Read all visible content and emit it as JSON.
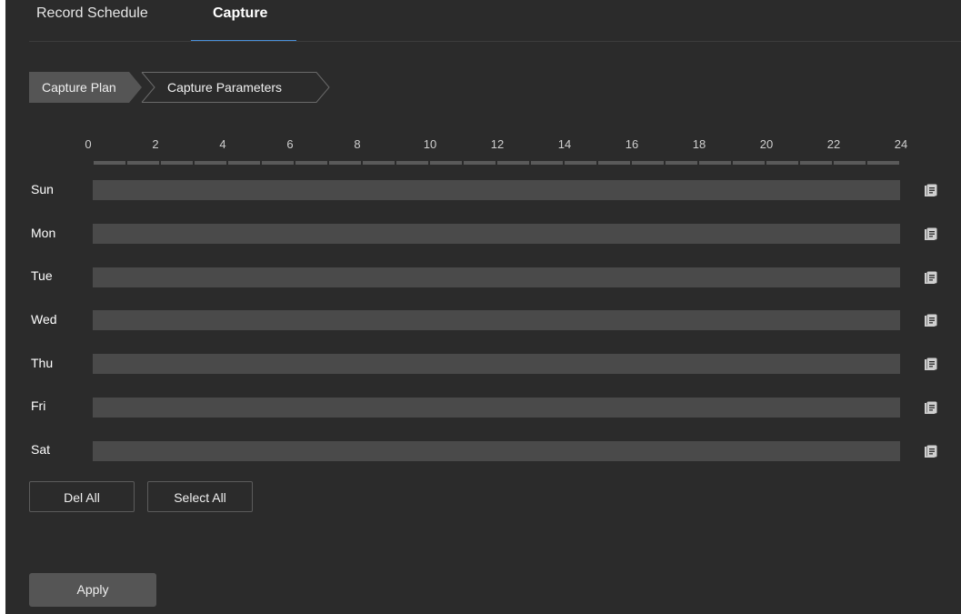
{
  "tabs": [
    {
      "label": "Record Schedule",
      "active": false
    },
    {
      "label": "Capture",
      "active": true
    }
  ],
  "steps": [
    {
      "label": "Capture Plan",
      "active": true
    },
    {
      "label": "Capture Parameters",
      "active": false
    }
  ],
  "scale": [
    "0",
    "2",
    "4",
    "6",
    "8",
    "10",
    "12",
    "14",
    "16",
    "18",
    "20",
    "22",
    "24"
  ],
  "days": [
    "Sun",
    "Mon",
    "Tue",
    "Wed",
    "Thu",
    "Fri",
    "Sat"
  ],
  "buttons": {
    "del_all": "Del All",
    "select_all": "Select All",
    "apply": "Apply"
  },
  "colors": {
    "background": "#2b2b2b",
    "accent": "#4a90d9",
    "bar": "#4a4a4a",
    "active_step": "#555555"
  }
}
